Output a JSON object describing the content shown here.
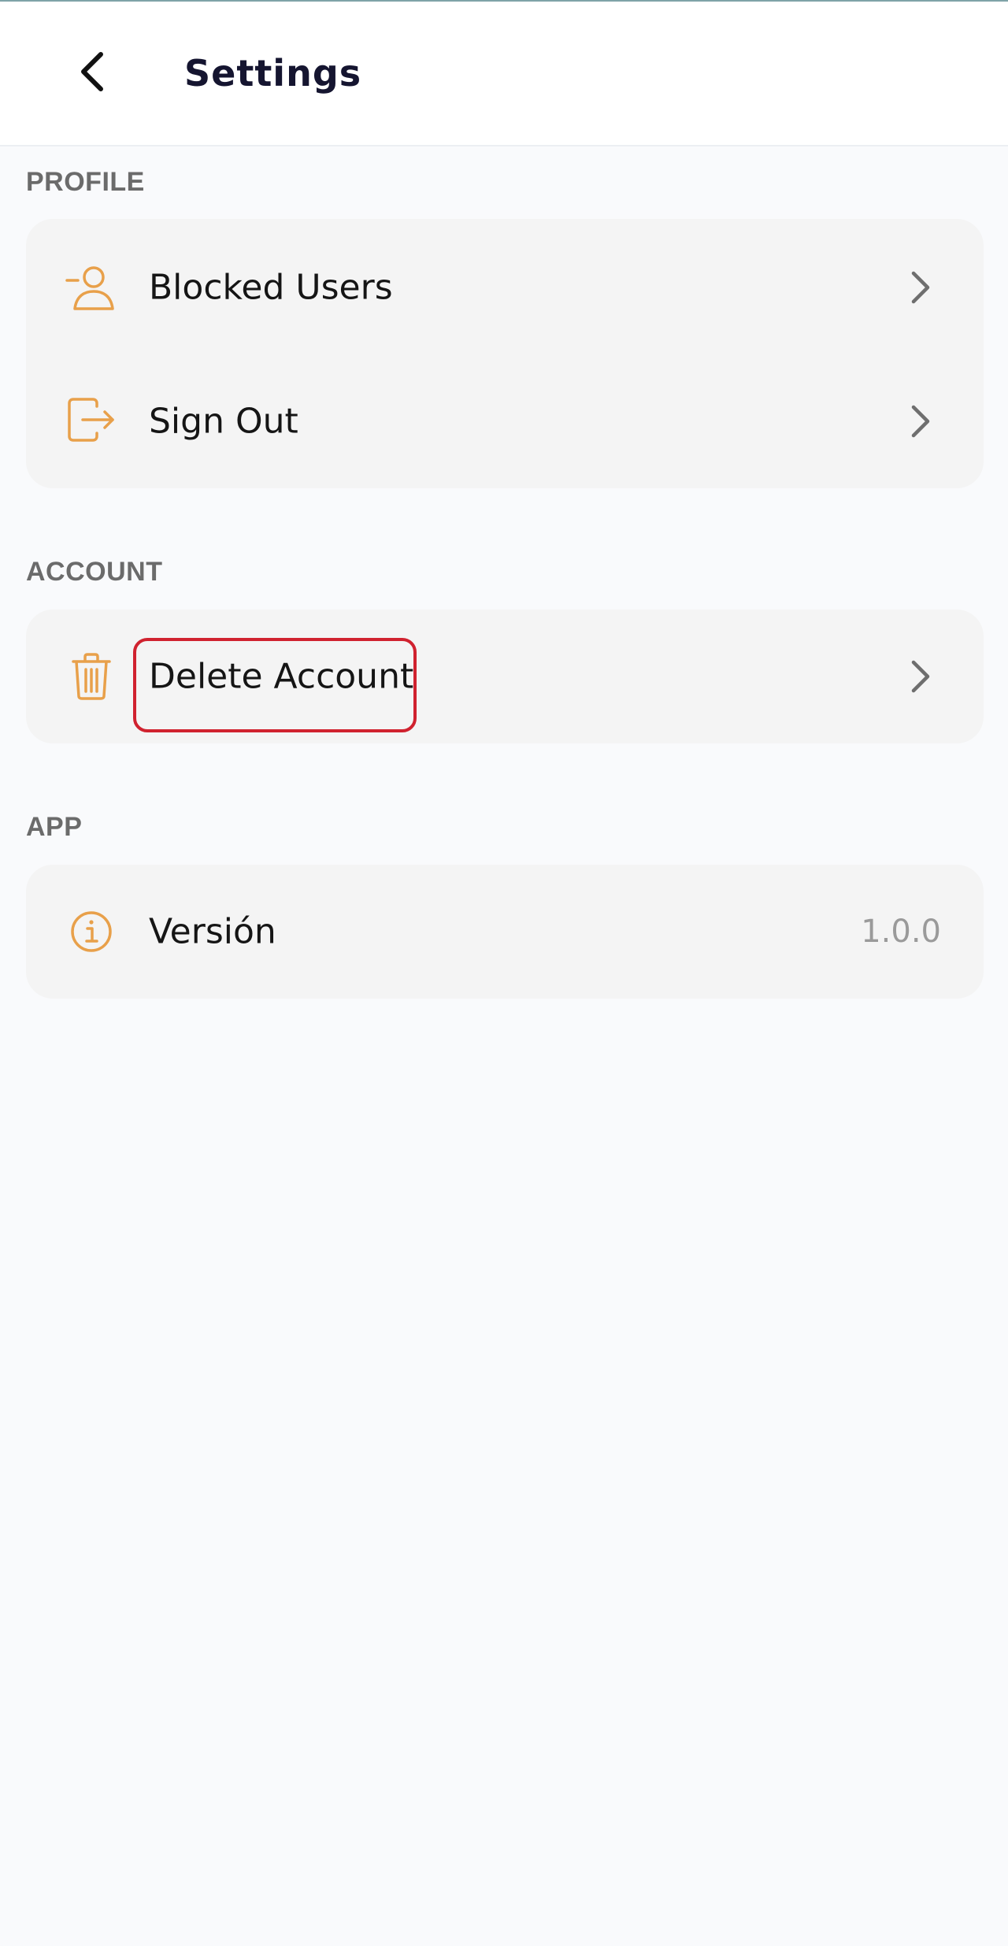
{
  "header": {
    "title": "Settings",
    "back_icon": "chevron-left-icon"
  },
  "sections": {
    "profile": {
      "label": "PROFILE",
      "items": [
        {
          "label": "Blocked Users",
          "icon": "user-minus-icon",
          "trailing": "chevron-right-icon"
        },
        {
          "label": "Sign Out",
          "icon": "sign-out-icon",
          "trailing": "chevron-right-icon"
        }
      ]
    },
    "account": {
      "label": "ACCOUNT",
      "items": [
        {
          "label": "Delete Account",
          "icon": "trash-icon",
          "trailing": "chevron-right-icon"
        }
      ]
    },
    "app": {
      "label": "APP",
      "items": [
        {
          "label": "Versión",
          "icon": "info-icon",
          "value": "1.0.0"
        }
      ]
    }
  },
  "colors": {
    "accent": "#e8a04a",
    "highlight": "#d0222f",
    "card_bg": "#f4f4f4",
    "page_bg": "#f9fafc"
  }
}
